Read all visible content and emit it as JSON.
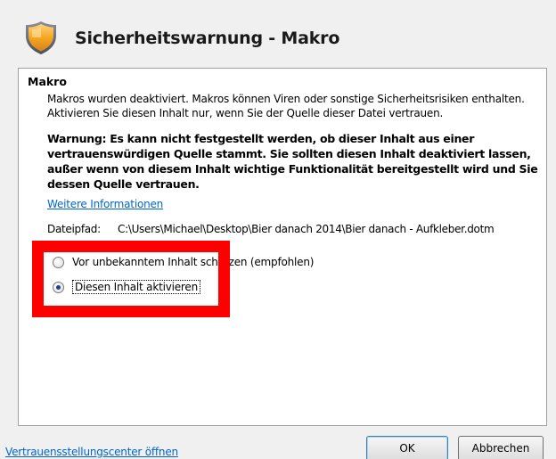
{
  "dialog": {
    "title": "Sicherheitswarnung - Makro"
  },
  "panel": {
    "section_label": "Makro",
    "description": "Makros wurden deaktiviert. Makros können Viren oder sonstige Sicherheitsrisiken enthalten. Aktivieren Sie diesen Inhalt nur, wenn Sie der Quelle dieser Datei vertrauen.",
    "warning": "Warnung: Es kann nicht festgestellt werden, ob dieser Inhalt aus einer vertrauenswürdigen Quelle stammt. Sie sollten diesen Inhalt deaktiviert lassen, außer wenn von diesem Inhalt wichtige Funktionalität bereitgestellt wird und Sie dessen Quelle vertrauen.",
    "more_info_link": "Weitere Informationen",
    "file_path_label": "Dateipfad:",
    "file_path_value": "C:\\Users\\Michael\\Desktop\\Bier danach 2014\\Bier danach - Aufkleber.dotm",
    "options": [
      {
        "label": "Vor unbekanntem Inhalt schützen (empfohlen)",
        "checked": false
      },
      {
        "label": "Diesen Inhalt aktivieren",
        "checked": true
      }
    ]
  },
  "footer": {
    "trust_center_link": "Vertrauensstellungscenter öffnen",
    "ok_label": "OK",
    "cancel_label": "Abbrechen"
  },
  "colors": {
    "highlight": "#ff0000",
    "link": "#0066cc",
    "shield": "#f5a623"
  },
  "icons": {
    "header": "security-shield-icon"
  }
}
